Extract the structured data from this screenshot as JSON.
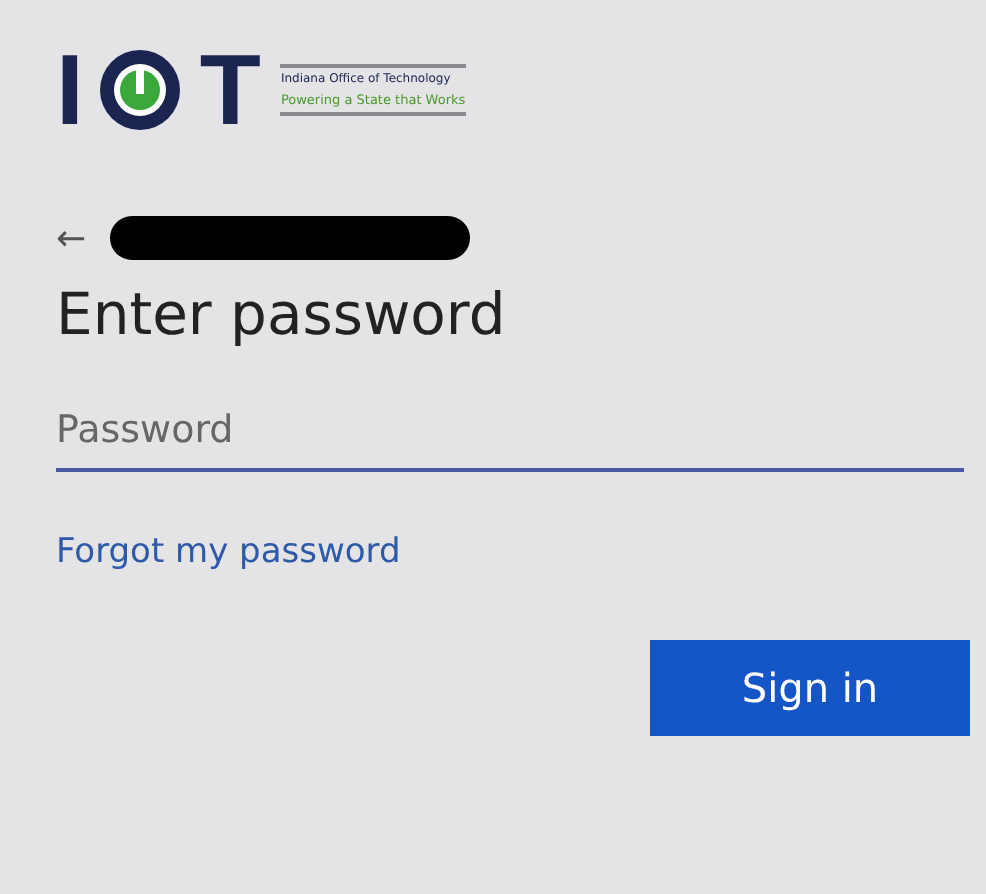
{
  "logo": {
    "letter_1": "I",
    "letter_2": "T",
    "name": "Indiana Office of Technology",
    "tagline": "Powering a State that Works"
  },
  "account": {
    "back": "←",
    "redacted": true
  },
  "title": "Enter password",
  "password": {
    "placeholder": "Password",
    "focused": true
  },
  "forgot_link": "Forgot my password",
  "buttons": [
    {
      "label": "Sign in",
      "kind": "primary"
    }
  ]
}
